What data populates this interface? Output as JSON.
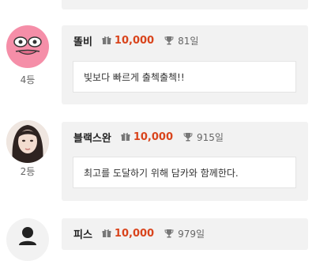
{
  "entries": [
    {
      "name": "똘비",
      "points": "10,000",
      "days": "81일",
      "rank": "4등",
      "message": "빛보다 빠르게 출첵출첵!!",
      "avatar": "pink-blob-face-icon"
    },
    {
      "name": "블랙스완",
      "points": "10,000",
      "days": "915일",
      "rank": "2등",
      "message": "최고를 도달하기 위해 담카와 함께한다.",
      "avatar": "portrait-photo"
    },
    {
      "name": "피스",
      "points": "10,000",
      "days": "979일",
      "rank": "",
      "message": "",
      "avatar": "user-silhouette-icon"
    }
  ],
  "colors": {
    "points": "#d9441c",
    "card_bg": "#f2f2f2",
    "avatar_pink": "#f58ea8"
  }
}
